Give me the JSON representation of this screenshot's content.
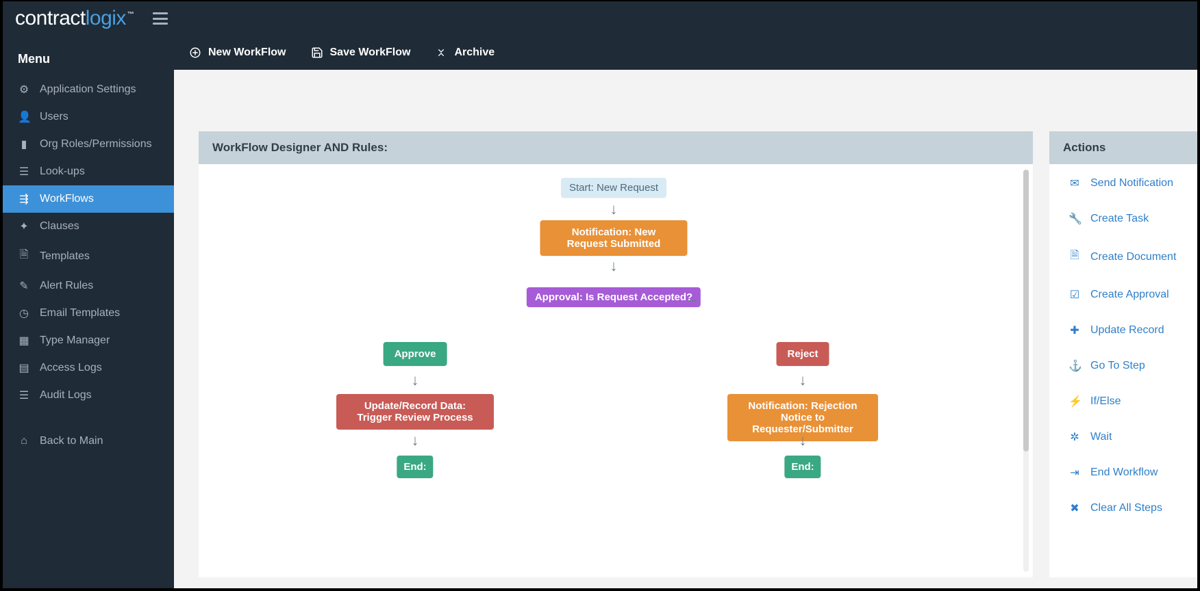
{
  "brand": {
    "part1": "contract",
    "part2": "logix"
  },
  "sidebar": {
    "title": "Menu",
    "items": [
      {
        "icon": "gears-icon",
        "glyph": "⚙",
        "label": "Application Settings"
      },
      {
        "icon": "user-icon",
        "glyph": "👤",
        "label": "Users"
      },
      {
        "icon": "book-icon",
        "glyph": "▮",
        "label": "Org Roles/Permissions"
      },
      {
        "icon": "list-icon",
        "glyph": "☰",
        "label": "Look-ups"
      },
      {
        "icon": "sitemap-icon",
        "glyph": "⇶",
        "label": "WorkFlows",
        "active": true
      },
      {
        "icon": "puzzle-icon",
        "glyph": "✦",
        "label": "Clauses"
      },
      {
        "icon": "file-icon",
        "glyph": "🗎",
        "label": "Templates"
      },
      {
        "icon": "edit-icon",
        "glyph": "✎",
        "label": "Alert Rules"
      },
      {
        "icon": "clock-icon",
        "glyph": "◷",
        "label": "Email Templates"
      },
      {
        "icon": "grid-icon",
        "glyph": "▦",
        "label": "Type Manager"
      },
      {
        "icon": "log-icon",
        "glyph": "▤",
        "label": "Access Logs"
      },
      {
        "icon": "log-icon",
        "glyph": "☰",
        "label": "Audit Logs"
      }
    ],
    "back": {
      "icon": "home-icon",
      "glyph": "⌂",
      "label": "Back to Main"
    }
  },
  "toolbar": {
    "items": [
      {
        "icon": "plus-circle-icon",
        "label": "New WorkFlow"
      },
      {
        "icon": "save-icon",
        "label": "Save WorkFlow"
      },
      {
        "icon": "archive-icon",
        "label": "Archive"
      }
    ]
  },
  "designer": {
    "title": "WorkFlow Designer AND Rules:",
    "nodes": {
      "start": "Start: New Request",
      "notif_new": "Notification: New Request Submitted",
      "approval": "Approval: Is Request Accepted?",
      "approve": "Approve",
      "reject": "Reject",
      "update": "Update/Record Data: Trigger Review Process",
      "notif_reject": "Notification: Rejection Notice to Requester/Submitter",
      "end": "End:"
    }
  },
  "actions": {
    "title": "Actions",
    "items": [
      {
        "icon": "envelope-icon",
        "glyph": "✉",
        "label": "Send Notification"
      },
      {
        "icon": "wrench-icon",
        "glyph": "🔧",
        "label": "Create Task"
      },
      {
        "icon": "document-icon",
        "glyph": "🗎",
        "label": "Create Document"
      },
      {
        "icon": "check-icon",
        "glyph": "☑",
        "label": "Create Approval"
      },
      {
        "icon": "plus-square-icon",
        "glyph": "✚",
        "label": "Update Record"
      },
      {
        "icon": "anchor-icon",
        "glyph": "⚓",
        "label": "Go To Step"
      },
      {
        "icon": "bolt-icon",
        "glyph": "⚡",
        "label": "If/Else"
      },
      {
        "icon": "gears-icon",
        "glyph": "✲",
        "label": "Wait"
      },
      {
        "icon": "end-icon",
        "glyph": "⇥",
        "label": "End Workflow"
      },
      {
        "icon": "close-icon",
        "glyph": "✖",
        "label": "Clear All Steps"
      }
    ]
  }
}
